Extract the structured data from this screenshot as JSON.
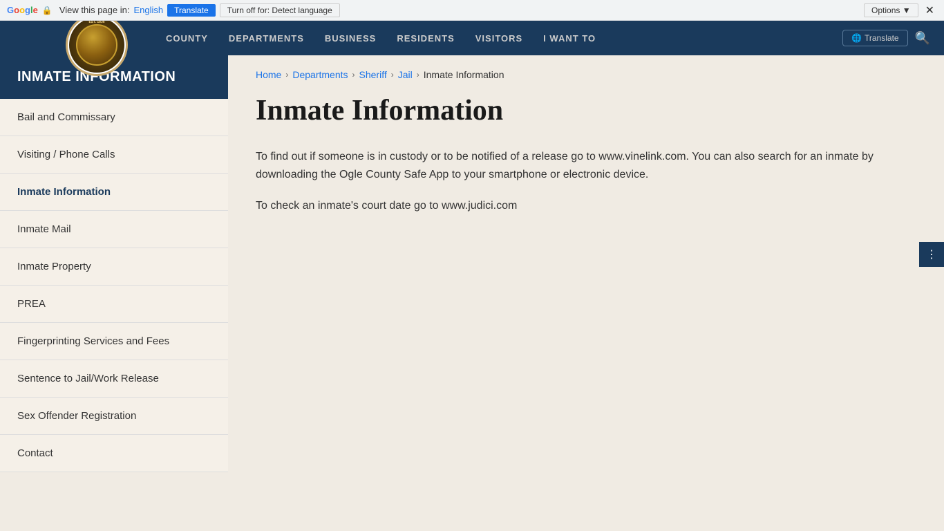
{
  "translate_bar": {
    "view_text": "View this page in:",
    "language_link": "English",
    "translate_btn": "Translate",
    "turnoff_btn": "Turn off for: Detect language",
    "options_btn": "Options ▼",
    "close_symbol": "✕"
  },
  "top_nav": {
    "links": [
      "COUNTY",
      "DEPARTMENTS",
      "BUSINESS",
      "RESIDENTS",
      "VISITORS",
      "I WANT TO"
    ],
    "translate_btn": "Translate"
  },
  "sidebar": {
    "header": "INMATE INFORMATION",
    "nav_items": [
      {
        "label": "Bail and Commissary",
        "href": "#",
        "active": false
      },
      {
        "label": "Visiting / Phone Calls",
        "href": "#",
        "active": false
      },
      {
        "label": "Inmate Information",
        "href": "#",
        "active": true
      },
      {
        "label": "Inmate Mail",
        "href": "#",
        "active": false
      },
      {
        "label": "Inmate Property",
        "href": "#",
        "active": false
      },
      {
        "label": "PREA",
        "href": "#",
        "active": false
      },
      {
        "label": "Fingerprinting Services and Fees",
        "href": "#",
        "active": false
      },
      {
        "label": "Sentence to Jail/Work Release",
        "href": "#",
        "active": false
      },
      {
        "label": "Sex Offender Registration",
        "href": "#",
        "active": false
      },
      {
        "label": "Contact",
        "href": "#",
        "active": false
      }
    ]
  },
  "breadcrumb": {
    "items": [
      {
        "label": "Home",
        "href": "#"
      },
      {
        "label": "Departments",
        "href": "#"
      },
      {
        "label": "Sheriff",
        "href": "#"
      },
      {
        "label": "Jail",
        "href": "#"
      },
      {
        "label": "Inmate Information",
        "current": true
      }
    ]
  },
  "main": {
    "page_title": "Inmate Information",
    "paragraph1": "To find out if someone is in custody or to be notified of a release go to www.vinelink.com.  You can also search for an inmate by downloading the Ogle County Safe App to your smartphone or electronic device.",
    "paragraph2": "To check an inmate's court date go to www.judici.com"
  }
}
